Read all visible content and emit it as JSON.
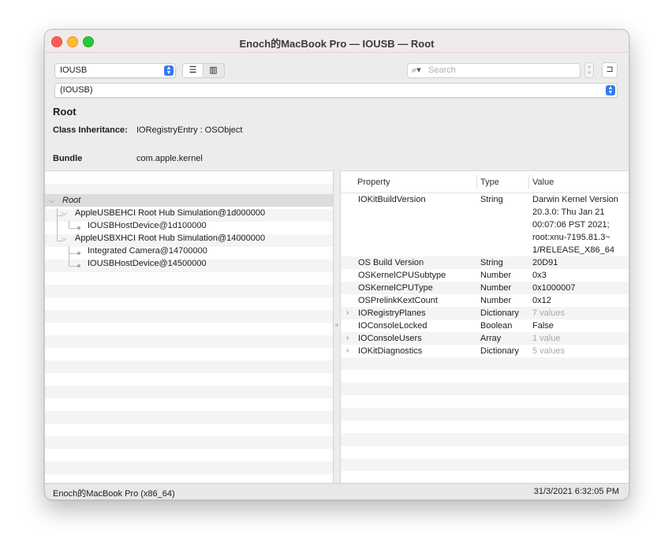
{
  "window": {
    "title": "Enoch的MacBook Pro — IOUSB — Root"
  },
  "toolbar": {
    "plane_value": "IOUSB",
    "path_value": "(IOUSB)",
    "list_view_icon": "☰",
    "column_view_icon": "▥",
    "search_icon": "⌕▾",
    "search_placeholder": "Search",
    "inspector_icon": "⊐"
  },
  "info": {
    "name": "Root",
    "class_label": "Class Inheritance:",
    "class_value": "IORegistryEntry : OSObject",
    "bundle_label": "Bundle",
    "bundle_value": "com.apple.kernel"
  },
  "tree": [
    {
      "label": "Root",
      "level": 0,
      "expanded": true,
      "italic": true
    },
    {
      "label": "AppleUSBEHCI Root Hub Simulation@1d000000",
      "level": 1,
      "expanded": true
    },
    {
      "label": "IOUSBHostDevice@1d100000",
      "level": 2
    },
    {
      "label": "AppleUSBXHCI Root Hub Simulation@14000000",
      "level": 1,
      "expanded": true
    },
    {
      "label": "Integrated Camera@14700000",
      "level": 2
    },
    {
      "label": "IOUSBHostDevice@14500000",
      "level": 2
    }
  ],
  "properties": {
    "headers": {
      "property": "Property",
      "type": "Type",
      "value": "Value"
    },
    "rows": [
      {
        "key": "IOKitBuildVersion",
        "type": "String",
        "value_lines": [
          "Darwin Kernel Version",
          "20.3.0: Thu Jan 21",
          "00:07:06 PST 2021;",
          "root:xnu-7195.81.3~",
          "1/RELEASE_X86_64"
        ]
      },
      {
        "key": "OS Build Version",
        "type": "String",
        "value": "20D91"
      },
      {
        "key": "OSKernelCPUSubtype",
        "type": "Number",
        "value": "0x3"
      },
      {
        "key": "OSKernelCPUType",
        "type": "Number",
        "value": "0x1000007"
      },
      {
        "key": "OSPrelinkKextCount",
        "type": "Number",
        "value": "0x12"
      },
      {
        "key": "IORegistryPlanes",
        "type": "Dictionary",
        "value": "7 values",
        "expandable": true
      },
      {
        "key": "IOConsoleLocked",
        "type": "Boolean",
        "value": "False"
      },
      {
        "key": "IOConsoleUsers",
        "type": "Array",
        "value": "1 value",
        "expandable": true
      },
      {
        "key": "IOKitDiagnostics",
        "type": "Dictionary",
        "value": "5 values",
        "expandable": true
      }
    ]
  },
  "status": {
    "left": "Enoch的MacBook Pro (x86_64)",
    "right": "31/3/2021 6:32:05 PM"
  },
  "icons": {
    "disclosure_open": "chevron-down-icon",
    "disclosure_closed": "chevron-right-icon",
    "accent_color": "#3478f6"
  }
}
